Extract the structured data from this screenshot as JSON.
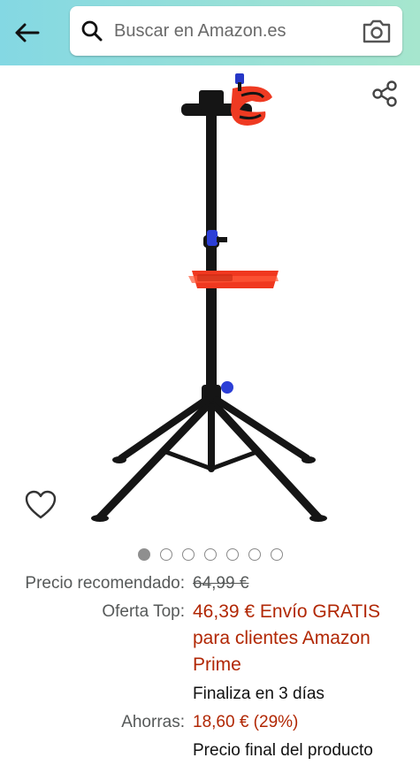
{
  "header": {
    "search_placeholder": "Buscar en Amazon.es"
  },
  "gallery": {
    "image_count": 7,
    "active_index": 0
  },
  "pricing": {
    "list_price_label": "Precio recomendado:",
    "list_price": "64,99 €",
    "deal_label": "Oferta Top:",
    "deal_price_line1": "46,39 € Envío GRATIS",
    "deal_price_line2": "para clientes Amazon",
    "deal_price_line3": "Prime",
    "deal_ends": "Finaliza en 3 días",
    "savings_label": "Ahorras:",
    "savings": "18,60 € (29%)",
    "final_price_note": "Precio final del producto"
  },
  "colors": {
    "header_gradient_start": "#84d8e3",
    "header_gradient_end": "#a6e6ce",
    "price_red": "#b12704",
    "muted_text": "#565959"
  },
  "icons": [
    "back-arrow-icon",
    "search-icon",
    "camera-icon",
    "share-icon",
    "heart-icon"
  ]
}
